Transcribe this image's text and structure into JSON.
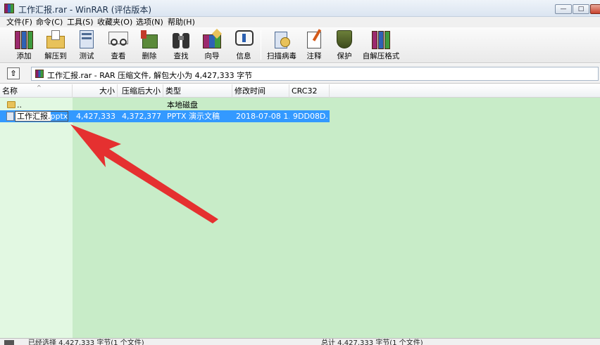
{
  "window": {
    "title": "工作汇报.rar - WinRAR (评估版本)",
    "minimize": "—",
    "maximize": "□",
    "close": "✕"
  },
  "menu": [
    "文件(F)",
    "命令(C)",
    "工具(S)",
    "收藏夹(O)",
    "选项(N)",
    "帮助(H)"
  ],
  "toolbar": {
    "add": "添加",
    "extract": "解压到",
    "test": "测试",
    "view": "查看",
    "delete": "删除",
    "find": "查找",
    "wizard": "向导",
    "info": "信息",
    "virus_scan": "扫描病毒",
    "comment": "注释",
    "protect": "保护",
    "sfx": "自解压格式"
  },
  "address": {
    "up": "⇧",
    "path": "工作汇报.rar - RAR 压缩文件, 解包大小为 4,427,333 字节"
  },
  "columns": {
    "name": "名称",
    "size": "大小",
    "packed": "压缩后大小",
    "type": "类型",
    "modified": "修改时间",
    "crc": "CRC32",
    "sort_indicator": "^"
  },
  "rows": [
    {
      "name": "..",
      "size": "",
      "packed": "",
      "type": "本地磁盘",
      "modified": "",
      "crc": ""
    },
    {
      "name_base": "工作汇报.",
      "name_ext": "pptx",
      "size": "4,427,333",
      "packed": "4,372,377",
      "type": "PPTX 演示文稿",
      "modified": "2018-07-08 1...",
      "crc": "9DD08D..."
    }
  ],
  "status": {
    "left": "已经选择 4,427,333 字节(1 个文件)",
    "right": "总计 4,427,333 字节(1 个文件)"
  },
  "colors": {
    "list_bg": "#c8ecc8",
    "selection": "#3399ff",
    "arrow": "#e53030"
  }
}
